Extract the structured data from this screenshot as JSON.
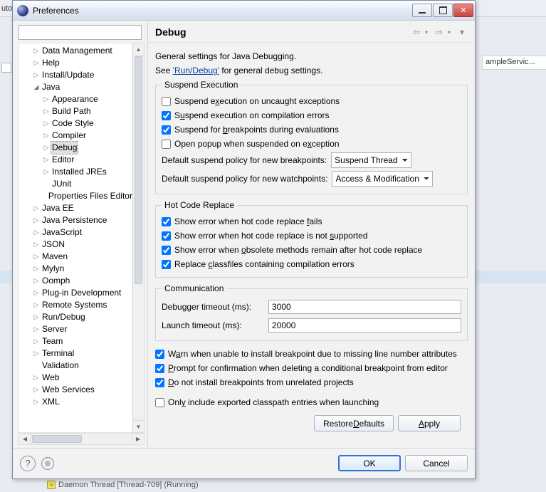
{
  "window": {
    "title": "Preferences"
  },
  "bg": {
    "corner": "uto",
    "serviceTab": "ampleServic...",
    "daemon": "Daemon Thread [Thread-709] (Running)"
  },
  "filter": {
    "placeholder": ""
  },
  "tree": {
    "items": [
      {
        "label": "Data Management",
        "depth": 0,
        "twisty": "closed"
      },
      {
        "label": "Help",
        "depth": 0,
        "twisty": "closed"
      },
      {
        "label": "Install/Update",
        "depth": 0,
        "twisty": "closed"
      },
      {
        "label": "Java",
        "depth": 0,
        "twisty": "open"
      },
      {
        "label": "Appearance",
        "depth": 1,
        "twisty": "closed"
      },
      {
        "label": "Build Path",
        "depth": 1,
        "twisty": "closed"
      },
      {
        "label": "Code Style",
        "depth": 1,
        "twisty": "closed"
      },
      {
        "label": "Compiler",
        "depth": 1,
        "twisty": "closed"
      },
      {
        "label": "Debug",
        "depth": 1,
        "twisty": "closed",
        "selected": true
      },
      {
        "label": "Editor",
        "depth": 1,
        "twisty": "closed"
      },
      {
        "label": "Installed JREs",
        "depth": 1,
        "twisty": "closed"
      },
      {
        "label": "JUnit",
        "depth": 1,
        "twisty": "none"
      },
      {
        "label": "Properties Files Editor",
        "depth": 1,
        "twisty": "none"
      },
      {
        "label": "Java EE",
        "depth": 0,
        "twisty": "closed"
      },
      {
        "label": "Java Persistence",
        "depth": 0,
        "twisty": "closed"
      },
      {
        "label": "JavaScript",
        "depth": 0,
        "twisty": "closed"
      },
      {
        "label": "JSON",
        "depth": 0,
        "twisty": "closed"
      },
      {
        "label": "Maven",
        "depth": 0,
        "twisty": "closed"
      },
      {
        "label": "Mylyn",
        "depth": 0,
        "twisty": "closed"
      },
      {
        "label": "Oomph",
        "depth": 0,
        "twisty": "closed"
      },
      {
        "label": "Plug-in Development",
        "depth": 0,
        "twisty": "closed"
      },
      {
        "label": "Remote Systems",
        "depth": 0,
        "twisty": "closed"
      },
      {
        "label": "Run/Debug",
        "depth": 0,
        "twisty": "closed"
      },
      {
        "label": "Server",
        "depth": 0,
        "twisty": "closed"
      },
      {
        "label": "Team",
        "depth": 0,
        "twisty": "closed"
      },
      {
        "label": "Terminal",
        "depth": 0,
        "twisty": "closed"
      },
      {
        "label": "Validation",
        "depth": 0,
        "twisty": "none"
      },
      {
        "label": "Web",
        "depth": 0,
        "twisty": "closed"
      },
      {
        "label": "Web Services",
        "depth": 0,
        "twisty": "closed"
      },
      {
        "label": "XML",
        "depth": 0,
        "twisty": "closed"
      }
    ]
  },
  "page": {
    "title": "Debug",
    "intro": "General settings for Java Debugging.",
    "see_prefix": "See ",
    "see_link": "'Run/Debug'",
    "see_suffix": " for general debug settings.",
    "grp_suspend": "Suspend Execution",
    "opt_suspend_uncaught": {
      "pre": "Suspend e",
      "u": "x",
      "post": "ecution on uncaught exceptions",
      "checked": false
    },
    "opt_suspend_compile": {
      "pre": "S",
      "u": "u",
      "post": "spend execution on compilation errors",
      "checked": true
    },
    "opt_suspend_eval": {
      "pre": "Suspend for ",
      "u": "b",
      "post": "reakpoints during evaluations",
      "checked": true
    },
    "opt_popup": {
      "pre": "Open popup when suspended on e",
      "u": "x",
      "post": "ception",
      "checked": false
    },
    "bp_policy_label": "Default suspend policy for new breakpoints:",
    "bp_policy_value": "Suspend Thread",
    "wp_policy_label_pre": "Default suspend policy for new ",
    "wp_policy_label_u": "w",
    "wp_policy_label_post": "atchpoints:",
    "wp_policy_value": "Access & Modification",
    "grp_hcr": "Hot Code Replace",
    "opt_hcr_fails": {
      "pre": "Show error when hot code replace ",
      "u": "f",
      "post": "ails",
      "checked": true
    },
    "opt_hcr_unsupported": {
      "pre": "Show error when hot code replace is not ",
      "u": "s",
      "post": "upported",
      "checked": true
    },
    "opt_hcr_obsolete": {
      "pre": "Show error when ",
      "u": "o",
      "post": "bsolete methods remain after hot code replace",
      "checked": true
    },
    "opt_hcr_replace": {
      "pre": "Replace ",
      "u": "c",
      "post": "lassfiles containing compilation errors",
      "checked": true
    },
    "grp_comm": "Communication",
    "debugger_timeout_label_pre": "Debugger ",
    "debugger_timeout_label_u": "t",
    "debugger_timeout_label_post": "imeout (ms):",
    "debugger_timeout_value": "3000",
    "launch_timeout_label_pre": "",
    "launch_timeout_label_u": "L",
    "launch_timeout_label_post": "aunch timeout (ms):",
    "launch_timeout_value": "20000",
    "opt_warn_line": {
      "pre": "W",
      "u": "a",
      "post": "rn when unable to install breakpoint due to missing line number attributes",
      "checked": true
    },
    "opt_prompt_delete": {
      "pre": "",
      "u": "P",
      "post": "rompt for confirmation when deleting a conditional breakpoint from editor",
      "checked": true
    },
    "opt_no_unrelated": {
      "pre": "",
      "u": "D",
      "post": "o not install breakpoints from unrelated projects",
      "checked": true
    },
    "opt_exported": {
      "pre": "Onl",
      "u": "y",
      "post": " include exported classpath entries when launching",
      "checked": false
    },
    "btn_restore": "Restore Defaults",
    "btn_apply": "Apply",
    "btn_ok": "OK",
    "btn_cancel": "Cancel"
  }
}
